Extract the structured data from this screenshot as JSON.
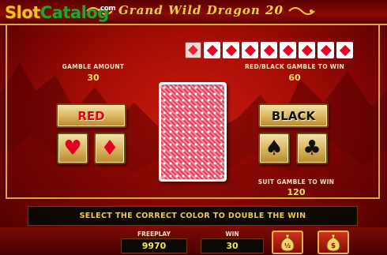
{
  "logo": {
    "slot": "Slot",
    "catalog": "Catalog",
    "suffix": ".com"
  },
  "header": {
    "title_text": "Grand Wild Dragon",
    "title_number": "20"
  },
  "gamble_amount": {
    "label": "GAMBLE AMOUNT",
    "value": "30"
  },
  "red_black_gamble": {
    "label": "RED/BLACK GAMBLE TO WIN",
    "value": "60"
  },
  "suit_gamble": {
    "label": "SUIT GAMBLE TO WIN",
    "value": "120"
  },
  "history": {
    "cards": [
      "diamond",
      "diamond",
      "diamond",
      "diamond",
      "diamond",
      "diamond",
      "diamond",
      "diamond",
      "diamond"
    ]
  },
  "buttons": {
    "red": "RED",
    "black": "BLACK",
    "heart": "♥",
    "diamond": "♦",
    "spade": "♠",
    "club": "♣"
  },
  "message": "SELECT THE CORRECT COLOR TO DOUBLE THE WIN",
  "bottom": {
    "freeplay_label": "FREEPLAY",
    "freeplay_value": "9970",
    "win_label": "WIN",
    "win_value": "30",
    "half_gamble_icon": "money-bag-half-icon",
    "collect_icon": "money-bag-icon"
  },
  "colors": {
    "accent_gold": "#d9a63a",
    "value_yellow": "#f7e35a",
    "suit_red": "#e3001c"
  }
}
